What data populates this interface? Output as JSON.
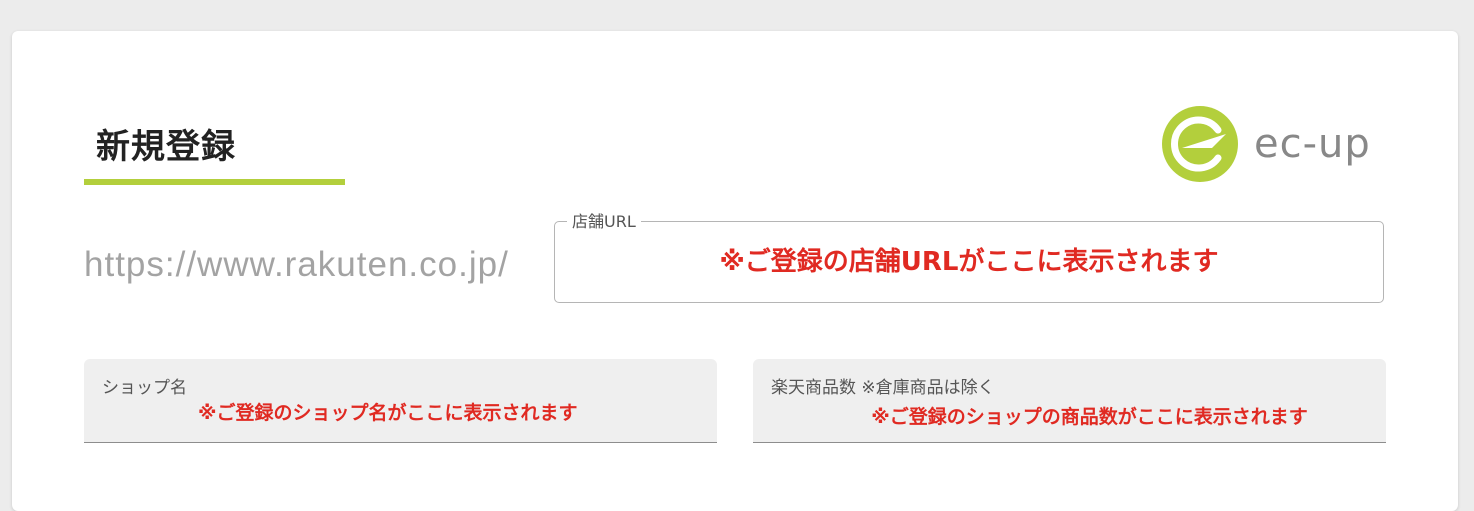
{
  "page": {
    "title": "新規登録"
  },
  "logo": {
    "text": "ec-up",
    "icon": "ec-up-logo-mark",
    "accent_color": "#b3cf3c"
  },
  "store_url": {
    "prefix": "https://www.rakuten.co.jp/",
    "label": "店舗URL",
    "value": "※ご登録の店舗URLがここに表示されます"
  },
  "shop_name": {
    "label": "ショップ名",
    "value": "※ご登録のショップ名がここに表示されます"
  },
  "item_count": {
    "label": "楽天商品数 ※倉庫商品は除く",
    "value": "※ご登録のショップの商品数がここに表示されます"
  },
  "colors": {
    "notice_red": "#e02a22",
    "accent_green": "#b3cf3c"
  }
}
